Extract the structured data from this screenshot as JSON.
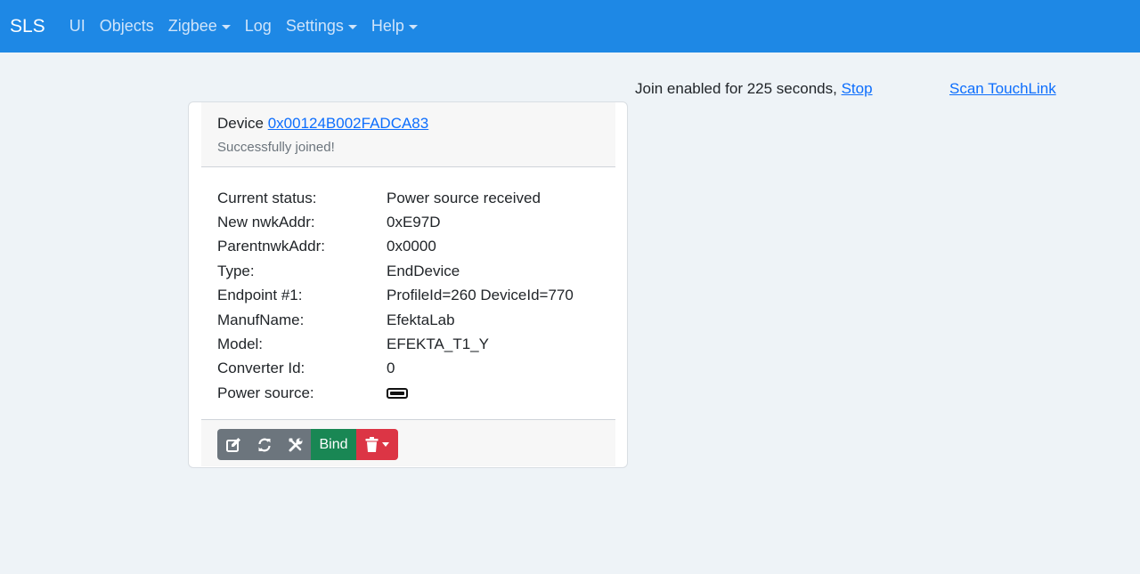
{
  "navbar": {
    "brand": "SLS",
    "items": [
      {
        "label": "UI",
        "dropdown": false
      },
      {
        "label": "Objects",
        "dropdown": false
      },
      {
        "label": "Zigbee",
        "dropdown": true
      },
      {
        "label": "Log",
        "dropdown": false
      },
      {
        "label": "Settings",
        "dropdown": true
      },
      {
        "label": "Help",
        "dropdown": true
      }
    ]
  },
  "join": {
    "text": "Join enabled for 225 seconds,",
    "stop_label": "Stop",
    "scan_label": "Scan TouchLink"
  },
  "card": {
    "device_prefix": "Device",
    "device_address": "0x00124B002FADCA83",
    "status_message": "Successfully joined!",
    "rows": [
      {
        "key": "Current status:",
        "value": "Power source received"
      },
      {
        "key": "New nwkAddr:",
        "value": "0xE97D"
      },
      {
        "key": "ParentnwkAddr:",
        "value": "0x0000"
      },
      {
        "key": "Type:",
        "value": "EndDevice"
      },
      {
        "key": "Endpoint #1:",
        "value": "ProfileId=260 DeviceId=770"
      },
      {
        "key": "ManufName:",
        "value": "EfektaLab"
      },
      {
        "key": "Model:",
        "value": "EFEKTA_T1_Y"
      },
      {
        "key": "Converter Id:",
        "value": "0"
      },
      {
        "key": "Power source:",
        "value": "",
        "icon": "battery-icon"
      }
    ],
    "buttons": {
      "edit_icon": "edit-icon",
      "refresh_icon": "refresh-icon",
      "tools_icon": "tools-icon",
      "bind_label": "Bind",
      "delete_icon": "trash-icon"
    }
  },
  "colors": {
    "navbar": "#1e88e5",
    "link": "#0d6efd",
    "bind": "#198754",
    "delete": "#dc3545",
    "gray_button": "#6c757d"
  }
}
